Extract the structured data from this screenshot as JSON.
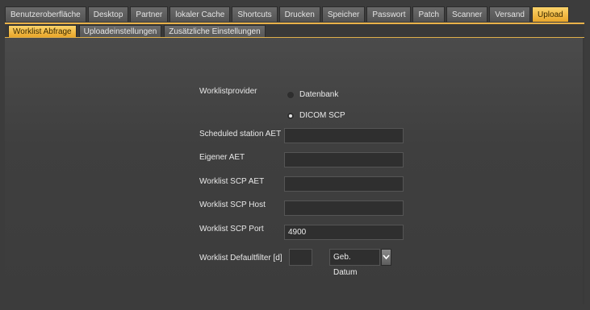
{
  "main_tabs": [
    {
      "label": "Benutzeroberfläche",
      "active": false
    },
    {
      "label": "Desktop",
      "active": false
    },
    {
      "label": "Partner",
      "active": false
    },
    {
      "label": "lokaler Cache",
      "active": false
    },
    {
      "label": "Shortcuts",
      "active": false
    },
    {
      "label": "Drucken",
      "active": false
    },
    {
      "label": "Speicher",
      "active": false
    },
    {
      "label": "Passwort",
      "active": false
    },
    {
      "label": "Patch",
      "active": false
    },
    {
      "label": "Scanner",
      "active": false
    },
    {
      "label": "Versand",
      "active": false
    },
    {
      "label": "Upload",
      "active": true
    }
  ],
  "sub_tabs": [
    {
      "label": "Worklist Abfrage",
      "active": true
    },
    {
      "label": "Uploadeinstellungen",
      "active": false
    },
    {
      "label": "Zusätzliche Einstellungen",
      "active": false
    }
  ],
  "form": {
    "worklistprovider_label": "Worklistprovider",
    "radio_datenbank": "Datenbank",
    "radio_dicom": "DICOM SCP",
    "scheduled_station_aet_label": "Scheduled station AET",
    "scheduled_station_aet_value": "",
    "eigener_aet_label": "Eigener AET",
    "eigener_aet_value": "",
    "worklist_scp_aet_label": "Worklist SCP AET",
    "worklist_scp_aet_value": "",
    "worklist_scp_host_label": "Worklist SCP Host",
    "worklist_scp_host_value": "",
    "worklist_scp_port_label": "Worklist SCP Port",
    "worklist_scp_port_value": "4900",
    "defaultfilter_label": "Worklist Defaultfilter [d]",
    "defaultfilter_value": "",
    "filter_select_value": "Geb. Datum"
  },
  "colors": {
    "accent": "#e9a62a",
    "background": "#3c3c3c"
  }
}
